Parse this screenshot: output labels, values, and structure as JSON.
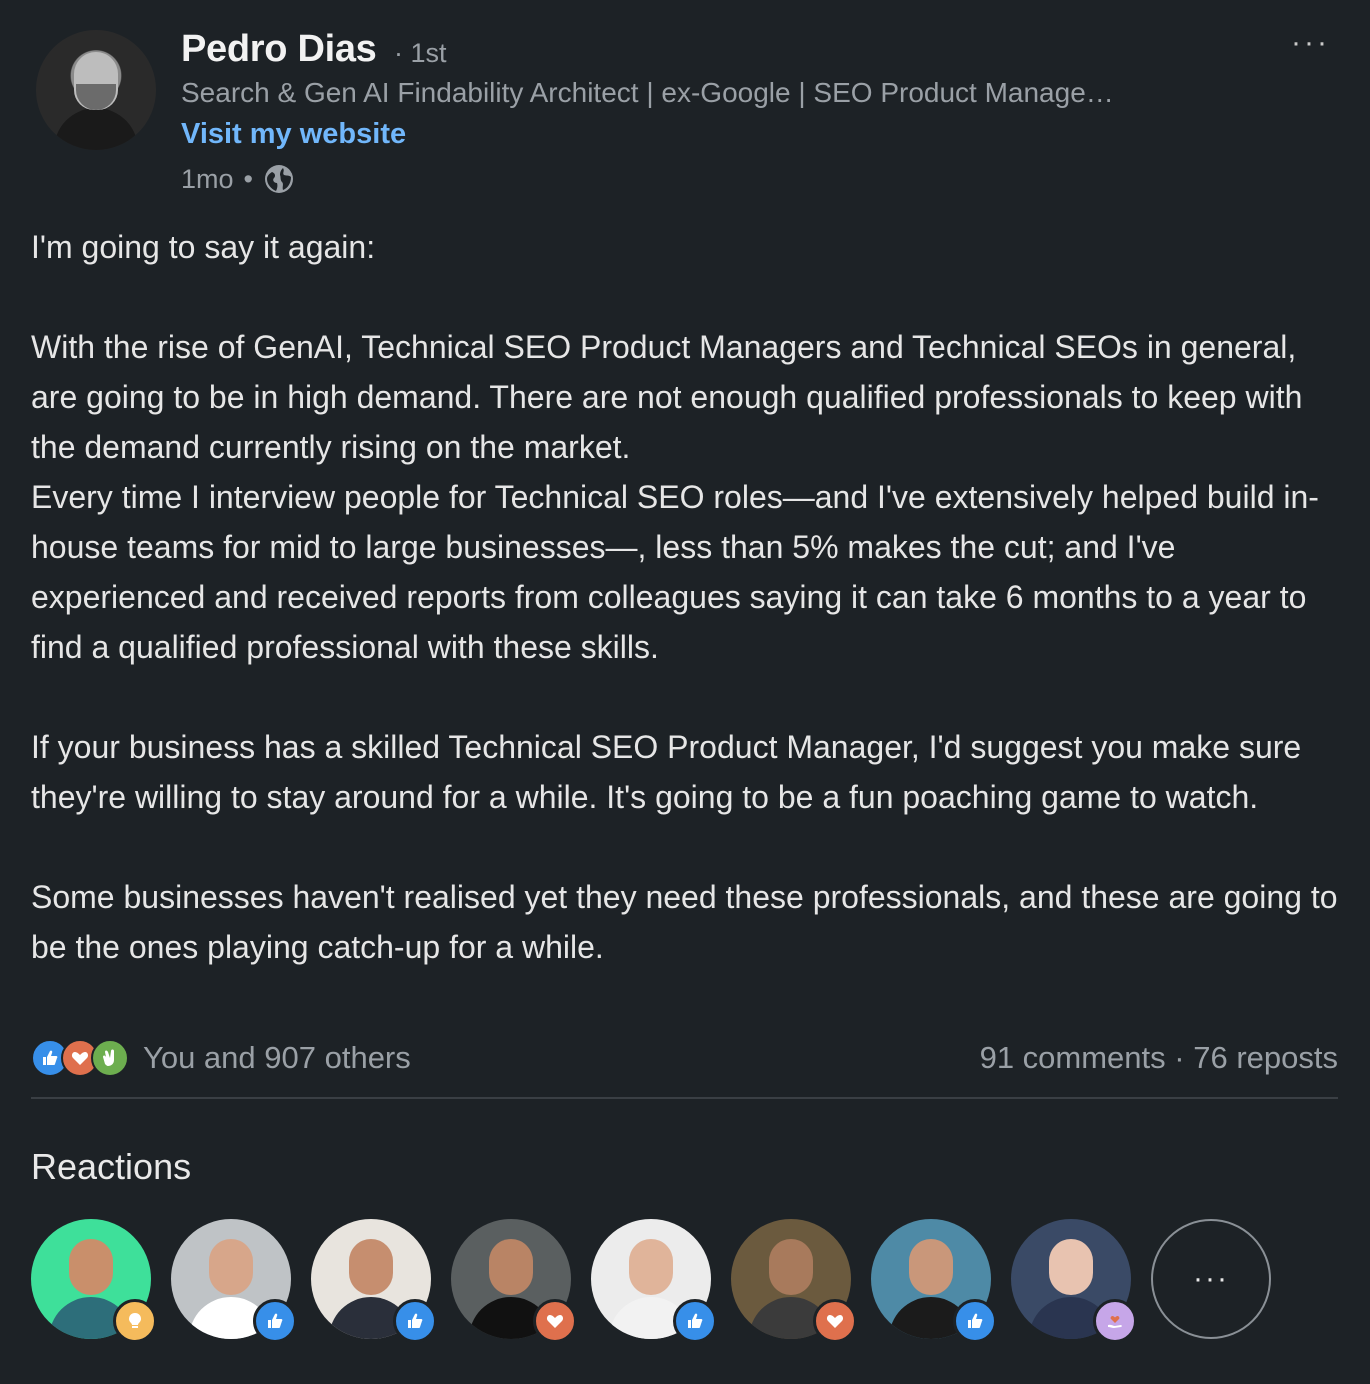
{
  "post": {
    "author_name": "Pedro Dias",
    "connection_degree": "· 1st",
    "headline": "Search & Gen AI Findability Architect | ex-Google | SEO Product Manage…",
    "website_label": "Visit my website",
    "time": "1mo",
    "time_separator": "•",
    "visibility_icon": "globe-icon",
    "more_label": "···",
    "paragraphs": [
      "I'm going to say it again:",
      "With the rise of GenAI, Technical SEO Product Managers and Technical SEOs in general, are going to be in high demand. There are not enough qualified professionals to keep with the demand currently rising on the market.",
      "Every time I interview people for Technical SEO roles—and I've extensively helped build in-house teams for mid to large businesses—, less than 5% makes the cut; and I've experienced and received reports from colleagues saying it can take 6 months to a year to find a qualified professional with these skills.",
      "If your business has a skilled Technical SEO Product Manager, I'd suggest you make sure they're willing to stay around for a while. It's going to be a fun poaching game to watch.",
      "Some businesses haven't realised yet they need these professionals, and these are going to be the ones playing catch-up for a while."
    ]
  },
  "social": {
    "reaction_icons": [
      "like-icon",
      "love-icon",
      "celebrate-icon"
    ],
    "reaction_count": "You and 907 others",
    "comments": "91 comments",
    "separator": "·",
    "reposts": "76 reposts"
  },
  "reactions": {
    "title": "Reactions",
    "more_label": "···",
    "people": [
      {
        "reaction": "insight",
        "bg": "#3ee09a"
      },
      {
        "reaction": "like",
        "bg": "#bfc3c6"
      },
      {
        "reaction": "like",
        "bg": "#e8e4de"
      },
      {
        "reaction": "love",
        "bg": "#5a5f60"
      },
      {
        "reaction": "like",
        "bg": "#ececec"
      },
      {
        "reaction": "love",
        "bg": "#6b5a3e"
      },
      {
        "reaction": "like",
        "bg": "#4e8aa6"
      },
      {
        "reaction": "support",
        "bg": "#3a4a66"
      }
    ]
  },
  "colors": {
    "background": "#1d2226",
    "link": "#71b7fb",
    "muted": "#9aa0a6",
    "like": "#378fe9",
    "love": "#df704d",
    "celebrate": "#6dae4f"
  }
}
